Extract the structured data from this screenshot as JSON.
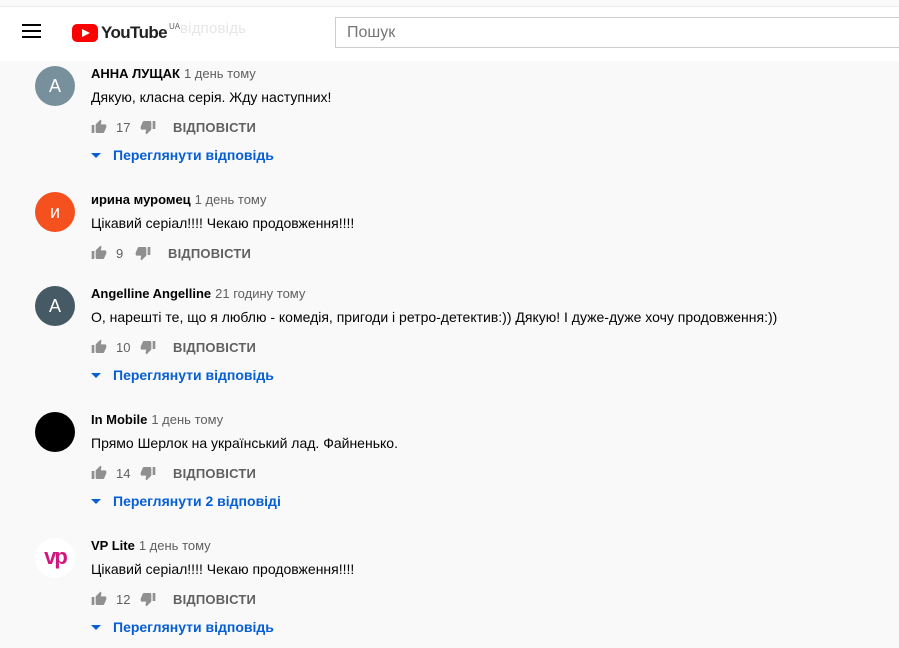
{
  "header": {
    "logo_text": "YouTube",
    "country_code": "UA",
    "ghost_text": "відповідь",
    "search_placeholder": "Пошук"
  },
  "comments": [
    {
      "author": "АННА ЛУЩАК",
      "time": "1 день тому",
      "text": "Дякую, класна серія. Жду наступних!",
      "likes": "17",
      "reply_label": "ВІДПОВІСТИ",
      "view_replies": "Переглянути відповідь",
      "avatar": {
        "letter": "А",
        "color": "#78909c"
      }
    },
    {
      "author": "ирина муромец",
      "time": "1 день тому",
      "text": "Цікавий серіал!!!!  Чекаю продовження!!!!",
      "likes": "9",
      "reply_label": "ВІДПОВІСТИ",
      "avatar": {
        "letter": "и",
        "color": "#f4511e"
      }
    },
    {
      "author": "Angelline Angelline",
      "time": "21 годину тому",
      "text": "О, нарешті те, що я люблю - комедія, пригоди і ретро-детектив:)) Дякую! І дуже-дуже хочу продовження:))",
      "likes": "10",
      "reply_label": "ВІДПОВІСТИ",
      "view_replies": "Переглянути відповідь",
      "avatar": {
        "letter": "A",
        "color": "#455a64"
      }
    },
    {
      "author": "In Mobile",
      "time": "1 день тому",
      "text": "Прямо Шерлок на український лад. Файненько.",
      "likes": "14",
      "reply_label": "ВІДПОВІСТИ",
      "view_replies": "Переглянути 2 відповіді",
      "avatar": {
        "color": "#000000"
      }
    },
    {
      "author": "VP Lite",
      "time": "1 день тому",
      "text": "Цікавий серіал!!!!  Чекаю продовження!!!!",
      "likes": "12",
      "reply_label": "ВІДПОВІСТИ",
      "view_replies": "Переглянути відповідь",
      "avatar": {
        "logo_text": "vp",
        "color": "#ffffff",
        "logo_color": "#d1177e"
      }
    }
  ]
}
